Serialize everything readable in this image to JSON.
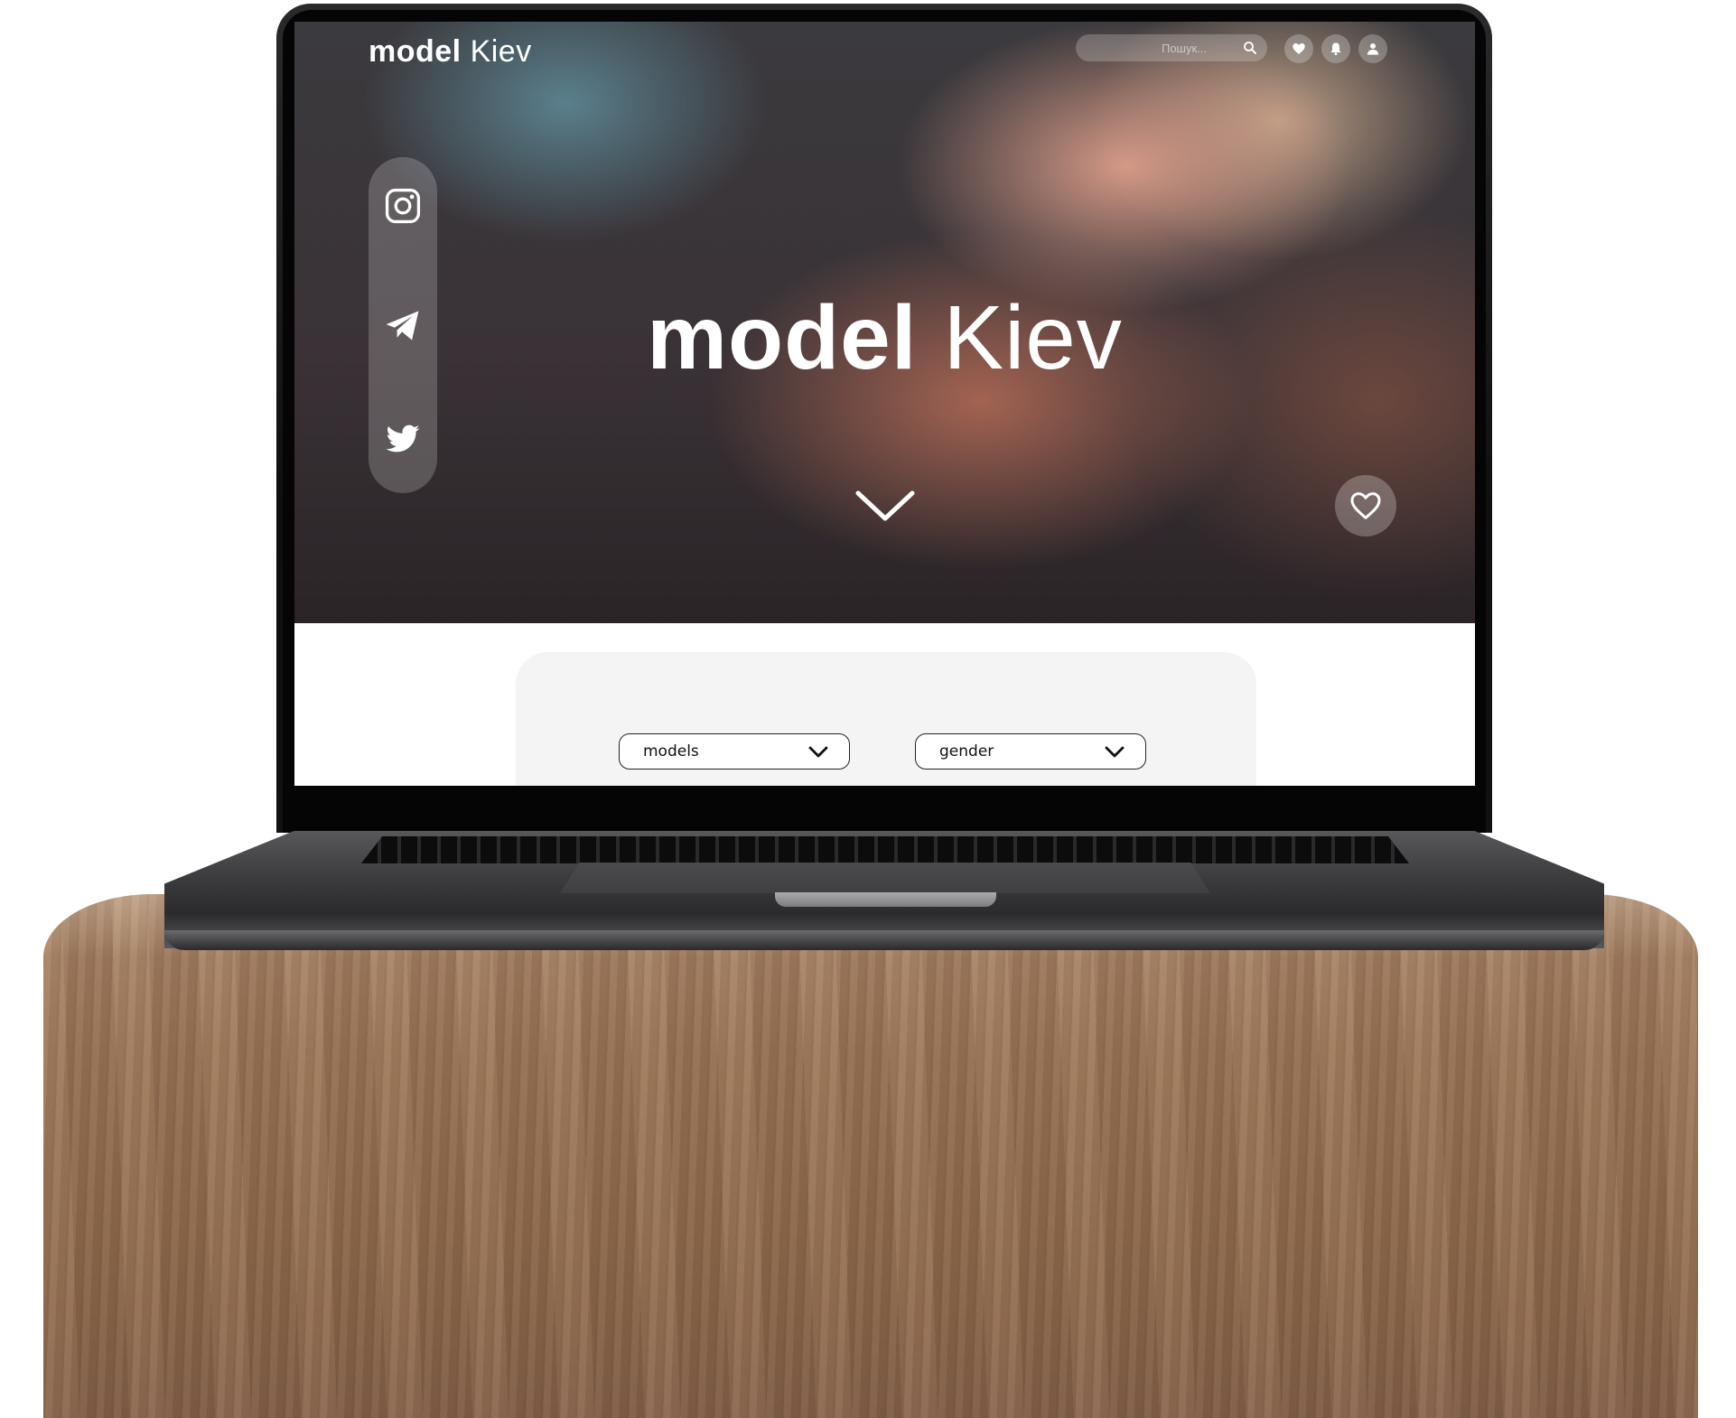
{
  "header": {
    "logo_bold": "model",
    "logo_light": "Kiev",
    "search_placeholder": "Пошук...",
    "icons": [
      "heart-icon",
      "bell-icon",
      "user-icon"
    ]
  },
  "social": {
    "icons": [
      "instagram-icon",
      "telegram-icon",
      "twitter-icon"
    ]
  },
  "hero": {
    "title_bold": "model",
    "title_light": "Kiev",
    "scroll_icon": "chevron-down-icon",
    "favorite_icon": "heart-outline-icon"
  },
  "filters": {
    "models_label": "models",
    "gender_label": "gender"
  },
  "colors": {
    "text_light": "#ffffff",
    "select_border": "#222222",
    "panel_bg": "#f4f4f4"
  }
}
